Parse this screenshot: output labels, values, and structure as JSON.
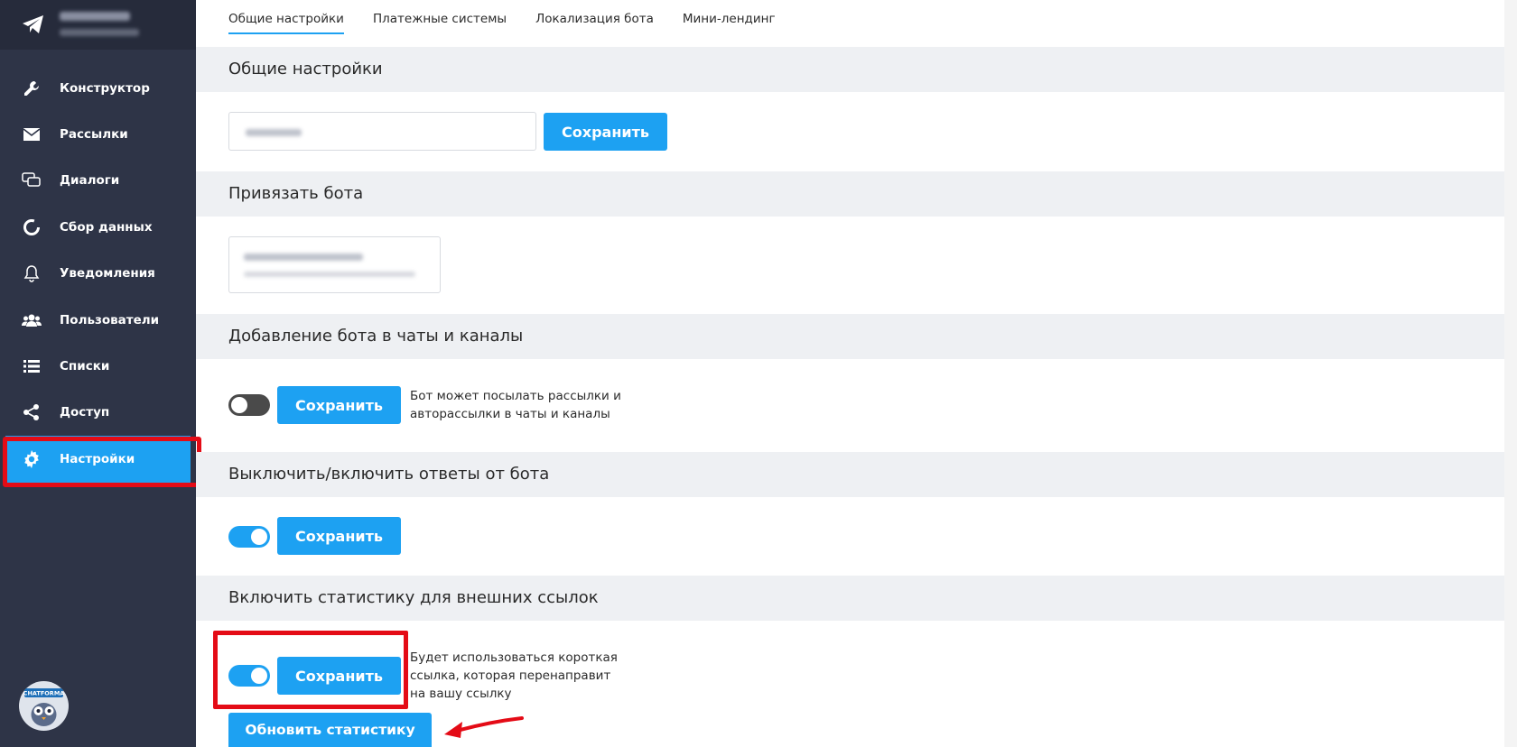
{
  "sidebar": {
    "items": [
      {
        "label": "Конструктор",
        "icon": "wrench-icon"
      },
      {
        "label": "Рассылки",
        "icon": "envelope-icon"
      },
      {
        "label": "Диалоги",
        "icon": "chat-bubbles-icon"
      },
      {
        "label": "Сбор данных",
        "icon": "circle-progress-icon"
      },
      {
        "label": "Уведомления",
        "icon": "bell-icon"
      },
      {
        "label": "Пользователи",
        "icon": "users-icon"
      },
      {
        "label": "Списки",
        "icon": "list-icon"
      },
      {
        "label": "Доступ",
        "icon": "share-icon"
      },
      {
        "label": "Настройки",
        "icon": "gear-icon",
        "active": true
      }
    ],
    "avatar_text": "CHATFORMA"
  },
  "tabs": [
    {
      "label": "Общие настройки",
      "active": true
    },
    {
      "label": "Платежные системы"
    },
    {
      "label": "Локализация бота"
    },
    {
      "label": "Мини-лендинг"
    }
  ],
  "sections": {
    "general": {
      "title": "Общие настройки",
      "save": "Сохранить"
    },
    "bind": {
      "title": "Привязать бота"
    },
    "chats": {
      "title": "Добавление бота в чаты и каналы",
      "save": "Сохранить",
      "desc": "Бот может посылать рассылки и авторассылки в чаты и каналы",
      "toggle_on": false
    },
    "replies": {
      "title": "Выключить/включить ответы от бота",
      "save": "Сохранить",
      "toggle_on": true
    },
    "stats": {
      "title": "Включить статистику для внешних ссылок",
      "save": "Сохранить",
      "desc": "Будет использоваться короткая ссылка, которая перенаправит на вашу ссылку",
      "toggle_on": true,
      "refresh": "Обновить статистику"
    }
  },
  "colors": {
    "accent": "#1da1f2",
    "sidebar": "#2e3447",
    "highlight": "#e40b16"
  }
}
